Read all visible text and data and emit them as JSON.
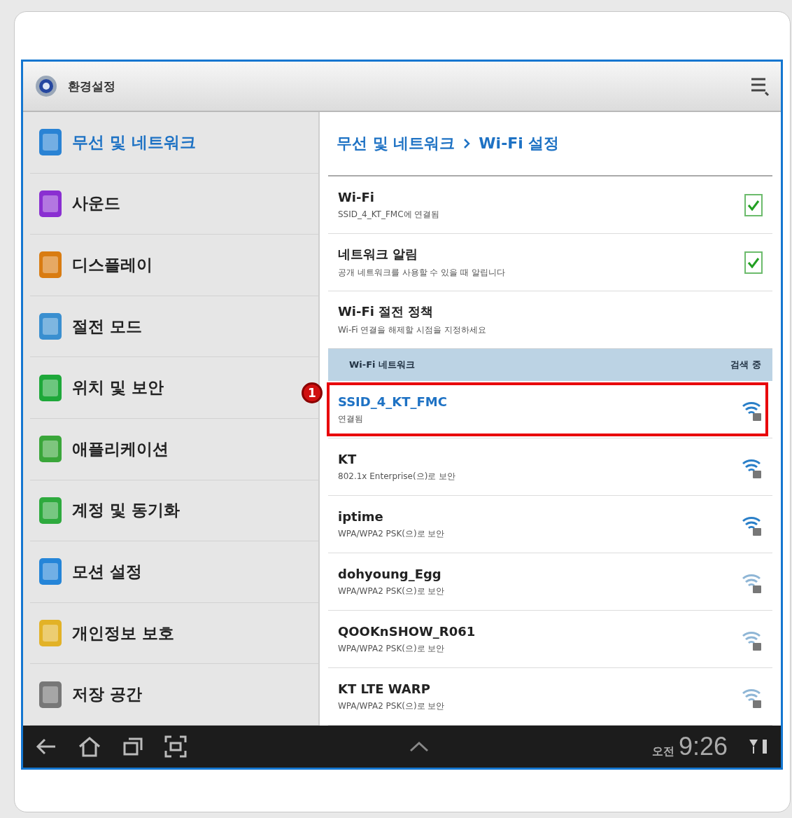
{
  "action_bar": {
    "title": "환경설정"
  },
  "sidebar": {
    "items": [
      {
        "label": "무선 및 네트워크",
        "kind": "wifi",
        "selected": true
      },
      {
        "label": "사운드",
        "kind": "sound",
        "selected": false
      },
      {
        "label": "디스플레이",
        "kind": "display",
        "selected": false
      },
      {
        "label": "절전 모드",
        "kind": "battery",
        "selected": false
      },
      {
        "label": "위치 및 보안",
        "kind": "location",
        "selected": false
      },
      {
        "label": "애플리케이션",
        "kind": "apps",
        "selected": false
      },
      {
        "label": "계정 및 동기화",
        "kind": "sync",
        "selected": false
      },
      {
        "label": "모션 설정",
        "kind": "motion",
        "selected": false
      },
      {
        "label": "개인정보 보호",
        "kind": "privacy",
        "selected": false
      },
      {
        "label": "저장 공간",
        "kind": "storage",
        "selected": false
      }
    ]
  },
  "breadcrumb": {
    "parent": "무선 및 네트워크",
    "current": "Wi-Fi 설정"
  },
  "settings": [
    {
      "title": "Wi-Fi",
      "summary": "SSID_4_KT_FMC에 연결됨",
      "kind": "checkbox",
      "checked": true
    },
    {
      "title": "네트워크 알림",
      "summary": "공개 네트워크를 사용할 수 있을 때 알립니다",
      "kind": "checkbox",
      "checked": true
    },
    {
      "title": "Wi-Fi 절전 정책",
      "summary": "Wi-Fi 연결을 해제할 시점을 지정하세요",
      "kind": "plain"
    }
  ],
  "networks_header": {
    "title": "Wi-Fi 네트워크",
    "status": "검색 중"
  },
  "networks": [
    {
      "name": "SSID_4_KT_FMC",
      "security": "연결됨",
      "connected": true,
      "strong_signal": true,
      "callout": "1"
    },
    {
      "name": "KT",
      "security": "802.1x Enterprise(으)로 보안",
      "connected": false,
      "strong_signal": true
    },
    {
      "name": "iptime",
      "security": "WPA/WPA2 PSK(으)로 보안",
      "connected": false,
      "strong_signal": true
    },
    {
      "name": "dohyoung_Egg",
      "security": "WPA/WPA2 PSK(으)로 보안",
      "connected": false,
      "strong_signal": false
    },
    {
      "name": "QOOKnSHOW_R061",
      "security": "WPA/WPA2 PSK(으)로 보안",
      "connected": false,
      "strong_signal": false
    },
    {
      "name": "KT LTE WARP",
      "security": "WPA/WPA2 PSK(으)로 보안",
      "connected": false,
      "strong_signal": false
    }
  ],
  "nav_bar": {
    "am_pm": "오전",
    "time": "9:26"
  }
}
